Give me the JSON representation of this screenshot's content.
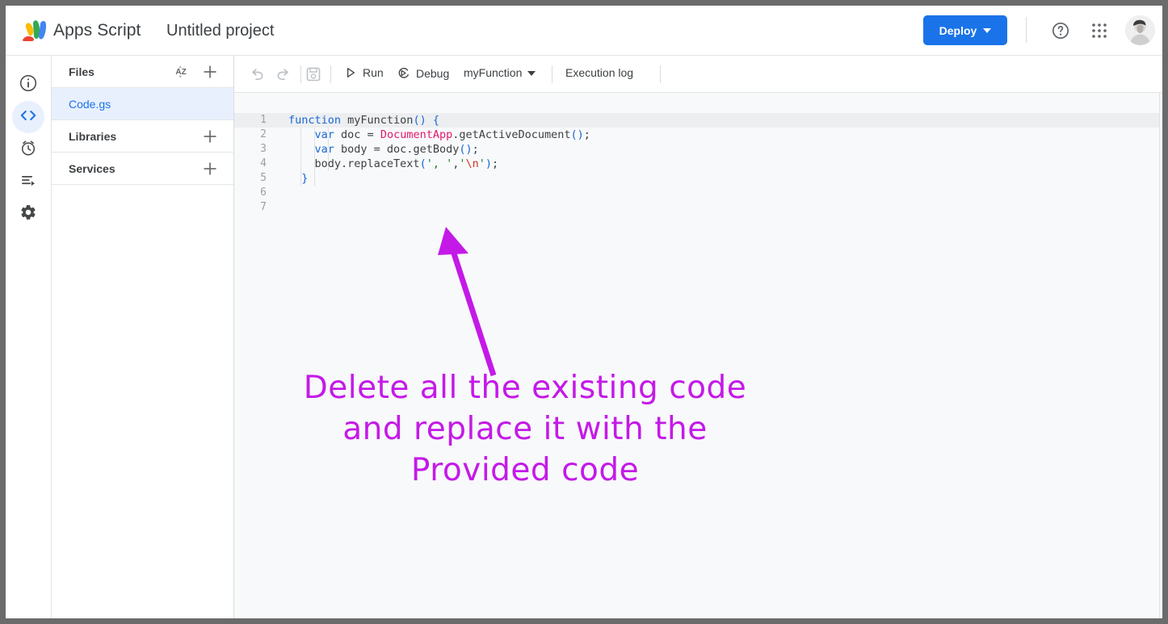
{
  "topbar": {
    "logo_icon": "apps-script-logo",
    "app_name": "Apps Script",
    "project_name": "Untitled project",
    "deploy_label": "Deploy",
    "deploy_caret_icon": "chevron-down-icon",
    "help_icon": "help-circle-icon",
    "apps_grid_icon": "apps-grid-icon",
    "avatar_icon": "user-avatar",
    "accent_color": "#1a73e8"
  },
  "rail": {
    "items": [
      {
        "name": "overview",
        "icon": "info-circle-icon",
        "selected": false
      },
      {
        "name": "editor",
        "icon": "code-brackets-icon",
        "selected": true
      },
      {
        "name": "triggers",
        "icon": "alarm-clock-icon",
        "selected": false
      },
      {
        "name": "executions",
        "icon": "executions-list-icon",
        "selected": false
      },
      {
        "name": "settings",
        "icon": "gear-icon",
        "selected": false
      }
    ]
  },
  "filepanel": {
    "files_header": "Files",
    "sort_icon": "sort-az-icon",
    "add_icon": "plus-icon",
    "files": [
      {
        "name": "Code.gs",
        "active": true
      }
    ],
    "libraries_header": "Libraries",
    "services_header": "Services"
  },
  "toolbar": {
    "undo_icon": "undo-icon",
    "redo_icon": "redo-icon",
    "save_icon": "save-floppy-icon",
    "run_label": "Run",
    "run_icon": "play-triangle-icon",
    "debug_label": "Debug",
    "debug_icon": "debug-icon",
    "function_select": "myFunction",
    "function_caret_icon": "chevron-down-icon",
    "execution_log_label": "Execution log"
  },
  "editor": {
    "line_numbers": [
      "1",
      "2",
      "3",
      "4",
      "5",
      "6",
      "7"
    ],
    "lines": [
      {
        "n": 1,
        "tokens": [
          {
            "t": "function",
            "c": "kw"
          },
          {
            "t": " myFunction",
            "c": ""
          },
          {
            "t": "()",
            "c": "pun"
          },
          {
            "t": " ",
            "c": ""
          },
          {
            "t": "{",
            "c": "pun"
          }
        ]
      },
      {
        "n": 2,
        "tokens": [
          {
            "t": "    ",
            "c": ""
          },
          {
            "t": "var",
            "c": "kw"
          },
          {
            "t": " doc = ",
            "c": ""
          },
          {
            "t": "DocumentApp",
            "c": "typ"
          },
          {
            "t": ".getActiveDocument",
            "c": ""
          },
          {
            "t": "()",
            "c": "pun"
          },
          {
            "t": ";",
            "c": ""
          }
        ]
      },
      {
        "n": 3,
        "tokens": [
          {
            "t": "    ",
            "c": ""
          },
          {
            "t": "var",
            "c": "kw"
          },
          {
            "t": " body = doc.getBody",
            "c": ""
          },
          {
            "t": "()",
            "c": "pun"
          },
          {
            "t": ";",
            "c": ""
          }
        ]
      },
      {
        "n": 4,
        "tokens": [
          {
            "t": "    body.replaceText",
            "c": ""
          },
          {
            "t": "(",
            "c": "pun"
          },
          {
            "t": "', '",
            "c": "str"
          },
          {
            "t": ",",
            "c": ""
          },
          {
            "t": "'",
            "c": "str"
          },
          {
            "t": "\\n",
            "c": "esc"
          },
          {
            "t": "'",
            "c": "str"
          },
          {
            "t": ")",
            "c": "pun"
          },
          {
            "t": ";",
            "c": ""
          }
        ]
      },
      {
        "n": 5,
        "tokens": [
          {
            "t": "  ",
            "c": ""
          },
          {
            "t": "}",
            "c": "pun"
          }
        ]
      },
      {
        "n": 6,
        "tokens": []
      },
      {
        "n": 7,
        "tokens": []
      }
    ]
  },
  "annotation": {
    "text": "Delete all the existing code and replace it with the Provided code",
    "line1": "Delete all the existing code",
    "line2": "and replace it with the",
    "line3": "Provided code",
    "color": "#c41ae8",
    "arrow_icon": "arrow-pointing-up-left"
  }
}
